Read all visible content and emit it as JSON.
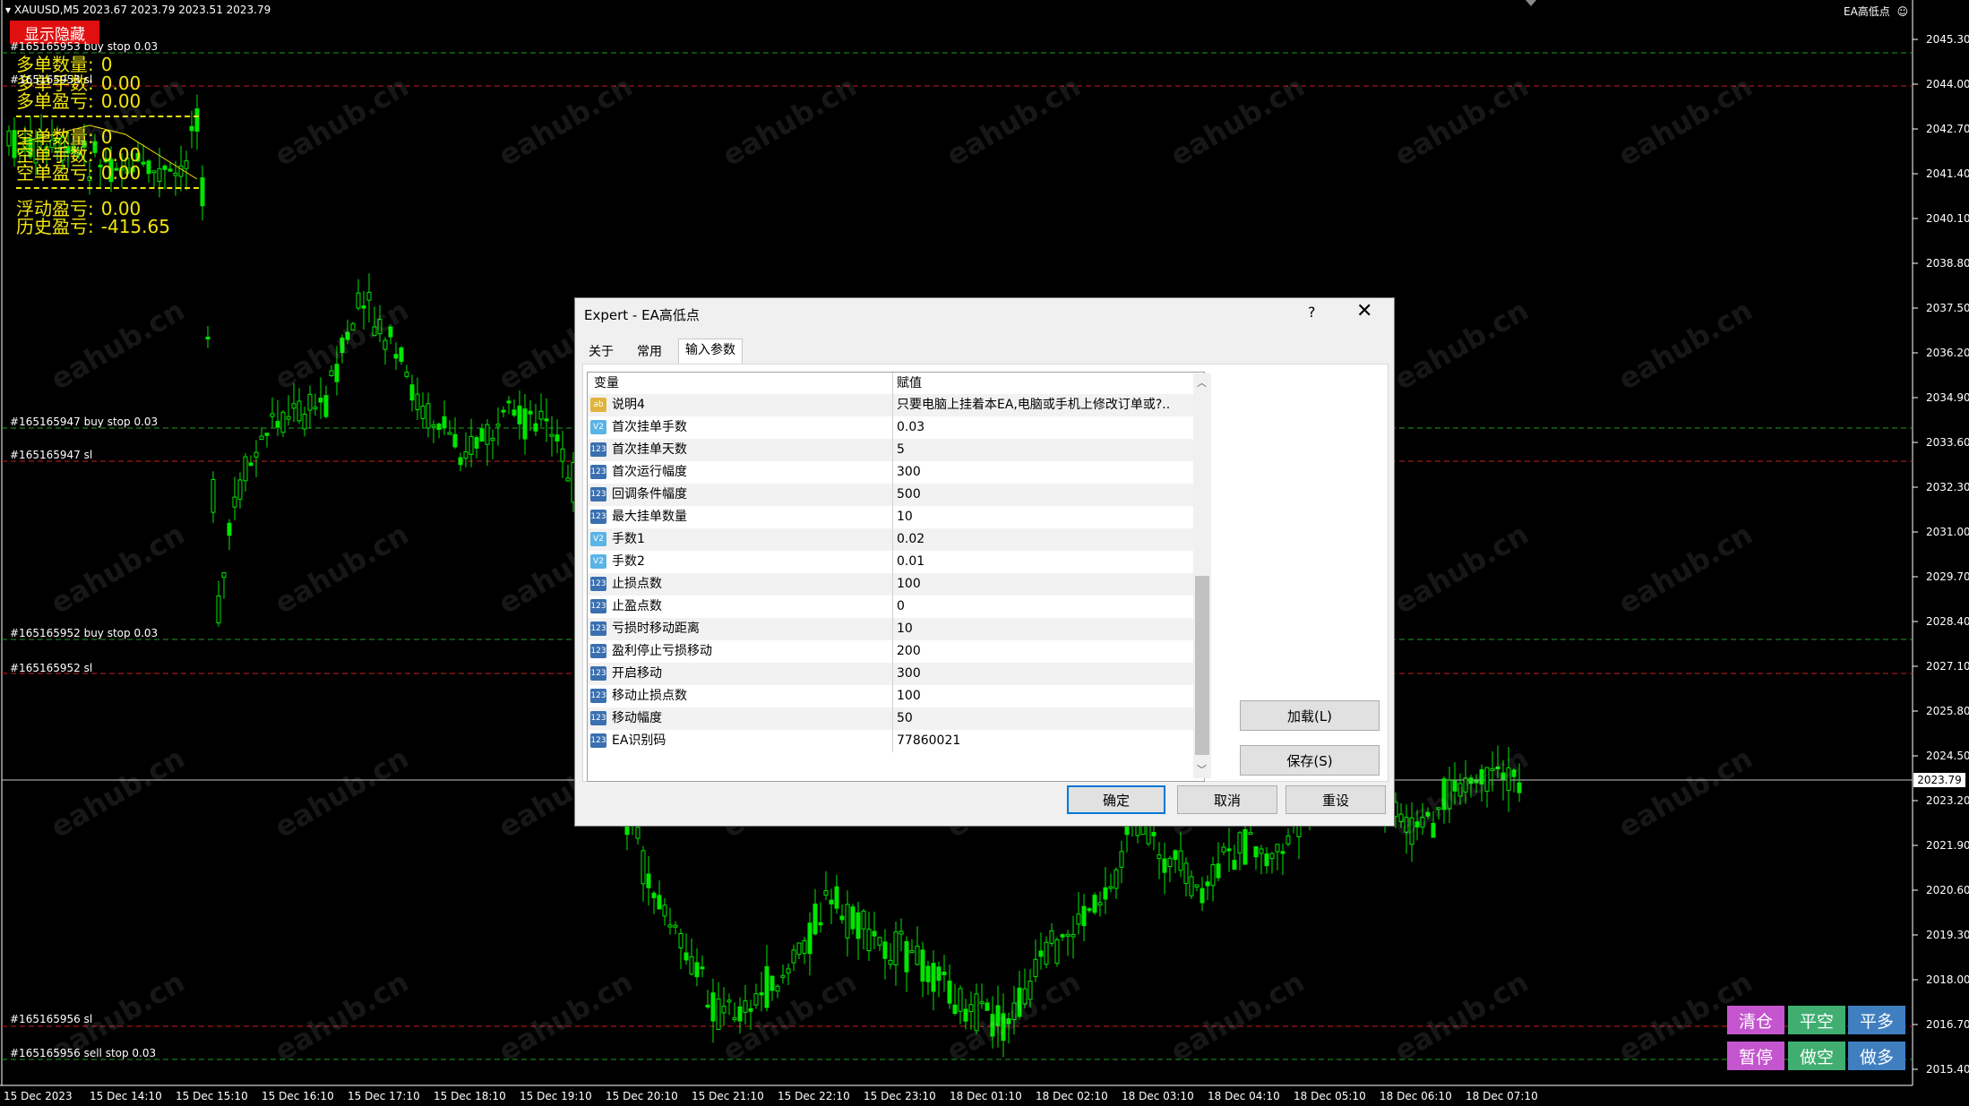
{
  "chart": {
    "header": "XAUUSD,M5  2023.67 2023.79 2023.51 2023.79",
    "ea_name": "EA高低点",
    "current_price": "2023.79",
    "price_labels": [
      "2045.30",
      "2044.00",
      "2042.70",
      "2041.40",
      "2040.10",
      "2038.80",
      "2037.50",
      "2036.20",
      "2034.90",
      "2033.60",
      "2032.30",
      "2031.00",
      "2029.70",
      "2028.40",
      "2027.10",
      "2025.80",
      "2024.50",
      "2023.20",
      "2021.90",
      "2020.60",
      "2019.30",
      "2018.00",
      "2016.70",
      "2015.40"
    ],
    "time_labels": [
      "15 Dec 2023",
      "15 Dec 14:10",
      "15 Dec 15:10",
      "15 Dec 16:10",
      "15 Dec 17:10",
      "15 Dec 18:10",
      "15 Dec 19:10",
      "15 Dec 20:10",
      "15 Dec 21:10",
      "15 Dec 22:10",
      "15 Dec 23:10",
      "18 Dec 01:10",
      "18 Dec 02:10",
      "18 Dec 03:10",
      "18 Dec 04:10",
      "18 Dec 05:10",
      "18 Dec 06:10",
      "18 Dec 07:10"
    ],
    "order_lines": [
      {
        "label": "#165165953 buy stop 0.03",
        "color": "#1f9e1f"
      },
      {
        "label": "#165165953 sl",
        "color": "#c81e1e"
      },
      {
        "label": "#165165947 buy stop 0.03",
        "color": "#1f9e1f"
      },
      {
        "label": "#165165947 sl",
        "color": "#c81e1e"
      },
      {
        "label": "#165165952 buy stop 0.03",
        "color": "#1f9e1f"
      },
      {
        "label": "#165165952 sl",
        "color": "#c81e1e"
      },
      {
        "label": "#165165956 sl",
        "color": "#c81e1e"
      },
      {
        "label": "#165165956 sell stop 0.03",
        "color": "#1f9e1f"
      }
    ],
    "watermark": "eahub.cn"
  },
  "panel": {
    "toggle_label": "显示隐藏",
    "long_count_label": "多单数量:",
    "long_count": "0",
    "long_lots_label": "多单手数:",
    "long_lots": "0.00",
    "long_profit_label": "多单盈亏:",
    "long_profit": "0.00",
    "short_count_label": "空单数量:",
    "short_count": "0",
    "short_lots_label": "空单手数:",
    "short_lots": "0.00",
    "short_profit_label": "空单盈亏:",
    "short_profit": "0.00",
    "float_label": "浮动盈亏:",
    "float_profit": "0.00",
    "history_label": "历史盈亏:",
    "history_profit": "-415.65"
  },
  "buttons": {
    "close_all": "清仓",
    "close_short": "平空",
    "close_long": "平多",
    "pause": "暂停",
    "sell": "做空",
    "buy": "做多",
    "colors": {
      "magenta": "#c455cf",
      "green": "#3fae70",
      "blue": "#3f7fbf"
    }
  },
  "dialog": {
    "title": "Expert - EA高低点",
    "help": "?",
    "close": "✕",
    "tabs": [
      "关于",
      "常用",
      "输入参数"
    ],
    "col_var": "变量",
    "col_val": "赋值",
    "params": [
      {
        "icon": "ab",
        "name": "说明4",
        "value": "只要电脑上挂着本EA,电脑或手机上修改订单或?.."
      },
      {
        "icon": "V2",
        "name": "首次挂单手数",
        "value": "0.03"
      },
      {
        "icon": "123",
        "name": "首次挂单天数",
        "value": "5"
      },
      {
        "icon": "123",
        "name": "首次运行幅度",
        "value": "300"
      },
      {
        "icon": "123",
        "name": "回调条件幅度",
        "value": "500"
      },
      {
        "icon": "123",
        "name": "最大挂单数量",
        "value": "10"
      },
      {
        "icon": "V2",
        "name": "手数1",
        "value": "0.02"
      },
      {
        "icon": "V2",
        "name": "手数2",
        "value": "0.01"
      },
      {
        "icon": "123",
        "name": "止损点数",
        "value": "100"
      },
      {
        "icon": "123",
        "name": "止盈点数",
        "value": "0"
      },
      {
        "icon": "123",
        "name": "亏损时移动距离",
        "value": "10"
      },
      {
        "icon": "123",
        "name": "盈利停止亏损移动",
        "value": "200"
      },
      {
        "icon": "123",
        "name": "开启移动",
        "value": "300"
      },
      {
        "icon": "123",
        "name": "移动止损点数",
        "value": "100"
      },
      {
        "icon": "123",
        "name": "移动幅度",
        "value": "50"
      },
      {
        "icon": "123",
        "name": "EA识别码",
        "value": "77860021"
      }
    ],
    "load": "加载(L)",
    "save": "保存(S)",
    "ok": "确定",
    "cancel": "取消",
    "reset": "重设"
  }
}
